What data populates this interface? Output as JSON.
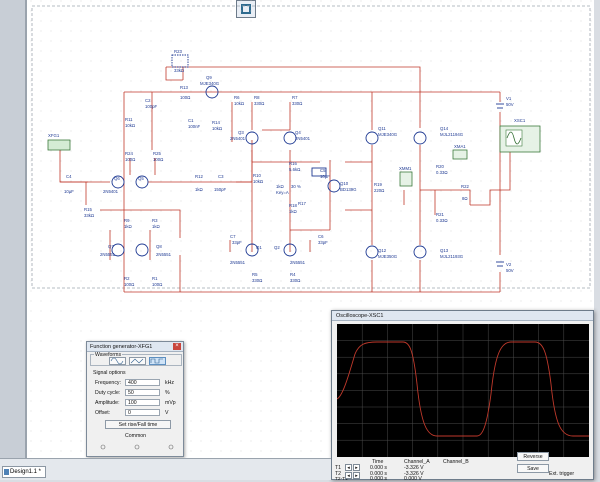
{
  "canvas": {
    "tab_label": "Design1.1 *",
    "labels": {
      "r23": "R23",
      "r23v": "33kΩ",
      "q9": "Q9",
      "q9m": "MJE340G",
      "r13": "R13",
      "r13v": "100Ω",
      "r6": "R6",
      "r6v": "10kΩ",
      "r8": "R8",
      "r8v": "330Ω",
      "r7": "R7",
      "r7v": "330Ω",
      "c2": "C2",
      "c2v": "100pF",
      "c1": "C1",
      "c1v": "100nF",
      "r14": "R14",
      "r14v": "10kΩ",
      "q3": "Q3",
      "q3m": "2N5401",
      "q4": "Q4",
      "q4m": "2N5401",
      "r11": "R11",
      "r11v": "10kΩ",
      "r24": "R24",
      "r24v": "100Ω",
      "r25": "R25",
      "r25v": "100Ω",
      "xfg1": "XFG1",
      "c4": "C4",
      "c4v": "10μF",
      "q6": "Q6",
      "q5": "Q5",
      "q65m": "2N5401",
      "r12": "R12",
      "r12v": "1kΩ",
      "c3": "C3",
      "c3v": "150pF",
      "r10": "R10",
      "r10v": "10kΩ",
      "r15": "R15",
      "r15v": "33kΩ",
      "r16": "R16",
      "r16v": "5.6kΩ",
      "pot": "1kΩ",
      "pot_pct": "30 %",
      "pot_key": "Key=A",
      "r17": "R17",
      "r18": "R18",
      "r18v": "1kΩ",
      "c5": "C5",
      "c5v": "10μF",
      "q10": "Q10",
      "q10m": "BD139G",
      "r9": "R9",
      "r9v": "1kΩ",
      "r3": "R3",
      "r3v": "1kΩ",
      "q7": "Q7",
      "q7m": "2N5551",
      "q8": "Q8",
      "q8m": "2N5551",
      "c7": "C7",
      "c7v": "33pF",
      "q1": "Q1",
      "q1m": "2N5551",
      "q2": "Q2",
      "q2m": "2N5551",
      "c6": "C6",
      "c6v": "33pF",
      "r2": "R2",
      "r2v": "100Ω",
      "r1": "R1",
      "r1v": "100Ω",
      "r5": "R5",
      "r5v": "330Ω",
      "r4": "R4",
      "r4v": "330Ω",
      "q11": "Q11",
      "q11m": "MJE340G",
      "q12": "Q12",
      "q12m": "MJE350G",
      "q14": "Q14",
      "q14m": "MJL21194G",
      "q13": "Q13",
      "q13m": "MJL21193G",
      "xmm1": "XMM1",
      "xma1": "XMA1",
      "r19": "R19",
      "r19v": "220Ω",
      "r20": "R20",
      "r20v": "0.33Ω",
      "r21": "R21",
      "r21v": "0.33Ω",
      "r22": "R22",
      "r22v": "8Ω",
      "v1": "V1",
      "v1v": "50V",
      "v2": "V2",
      "v2v": "50V",
      "xsc1": "XSC1"
    }
  },
  "function_generator": {
    "title": "Function generator-XFG1",
    "waveforms_label": "Waveforms",
    "selected_waveform": "square",
    "signal_options_label": "Signal options",
    "frequency_label": "Frequency:",
    "frequency_value": "400",
    "frequency_unit": "kHz",
    "duty_label": "Duty cycle:",
    "duty_value": "50",
    "duty_unit": "%",
    "amplitude_label": "Amplitude:",
    "amplitude_value": "100",
    "amplitude_unit": "mVp",
    "offset_label": "Offset:",
    "offset_value": "0",
    "offset_unit": "V",
    "set_rise_fall_label": "Set rise/Fall time",
    "common_label": "Common"
  },
  "oscilloscope": {
    "title": "Oscilloscope-XSC1",
    "trace_color": "#c0392b",
    "headers": {
      "time": "Time",
      "channel_a": "Channel_A",
      "channel_b": "Channel_B"
    },
    "rows": [
      {
        "label": "T1",
        "time": "0.000 s",
        "channel_a": "-3.326 V"
      },
      {
        "label": "T2",
        "time": "0.000 s",
        "channel_a": "-3.326 V"
      },
      {
        "label": "T2-T1",
        "time": "0.000 s",
        "channel_a": "0.000 V"
      }
    ],
    "reverse_label": "Reverse",
    "save_label": "Save",
    "ext_trigger_label": "Ext. trigger"
  },
  "colors": {
    "wire": "#c0392b",
    "component": "#1f3a93",
    "grid_dot": "#cfcfcf",
    "accent": "#cc3333"
  }
}
